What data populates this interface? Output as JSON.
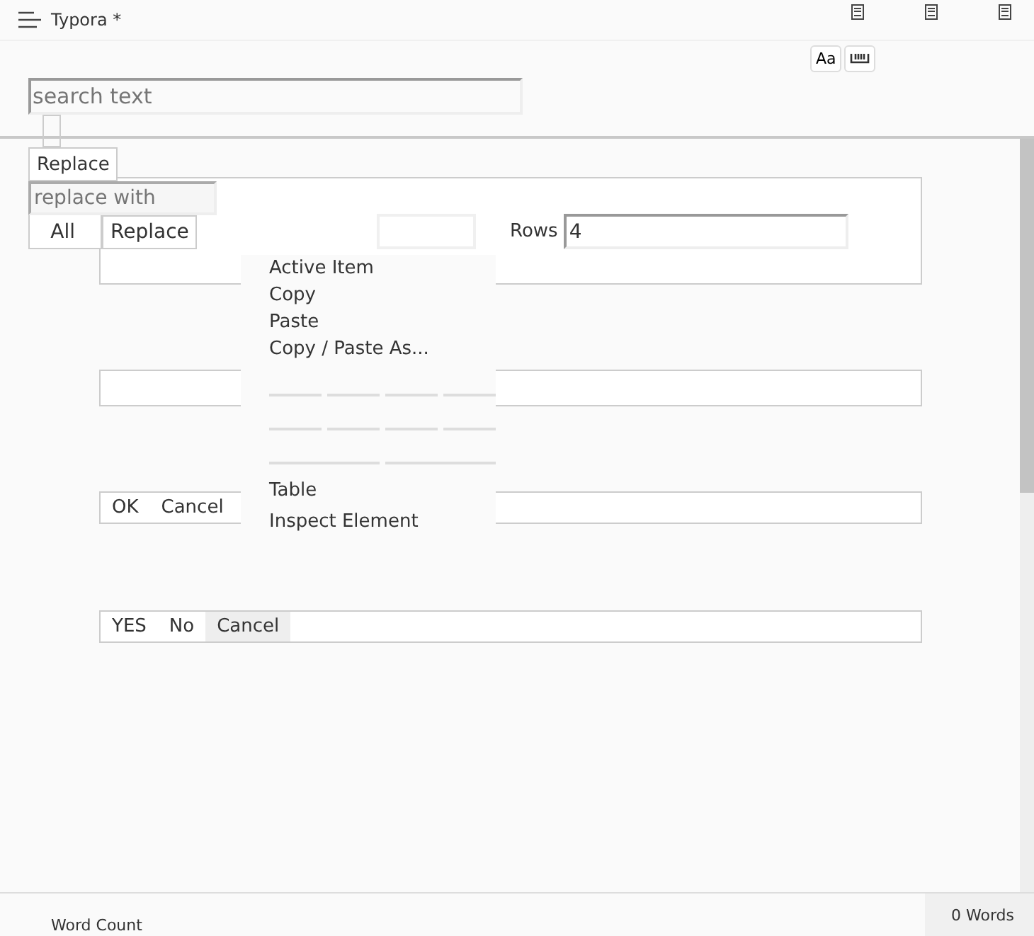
{
  "window": {
    "title": "Typora *"
  },
  "find_panel": {
    "search": {
      "placeholder": "search text"
    },
    "case_button": "Aa",
    "replace_toggle": "Replace",
    "replace": {
      "placeholder": "replace with"
    },
    "buttons": [
      "All",
      "Replace"
    ]
  },
  "table_dialog": {
    "rows_label": "Rows",
    "rows_value": "4"
  },
  "context_menu": {
    "items": [
      {
        "label": "Active Item",
        "kind": "text"
      },
      {
        "label": "Copy",
        "kind": "text"
      },
      {
        "label": "Paste",
        "kind": "text"
      },
      {
        "label": "Copy / Paste As...",
        "kind": "text"
      },
      {
        "kind": "spacer"
      },
      {
        "kind": "spacer"
      },
      {
        "kind": "spacer"
      },
      {
        "label": "Table",
        "kind": "text"
      },
      {
        "label": "Inspect Element",
        "kind": "text"
      }
    ]
  },
  "button_bars": [
    [
      {
        "label": "OK",
        "selected": false
      },
      {
        "label": "Cancel",
        "selected": false
      }
    ],
    [
      {
        "label": "YES",
        "selected": false
      },
      {
        "label": "No",
        "selected": false
      },
      {
        "label": "Cancel",
        "selected": true
      }
    ]
  ],
  "status_bar": {
    "left": "Word Count",
    "word_count": "0 Words"
  }
}
